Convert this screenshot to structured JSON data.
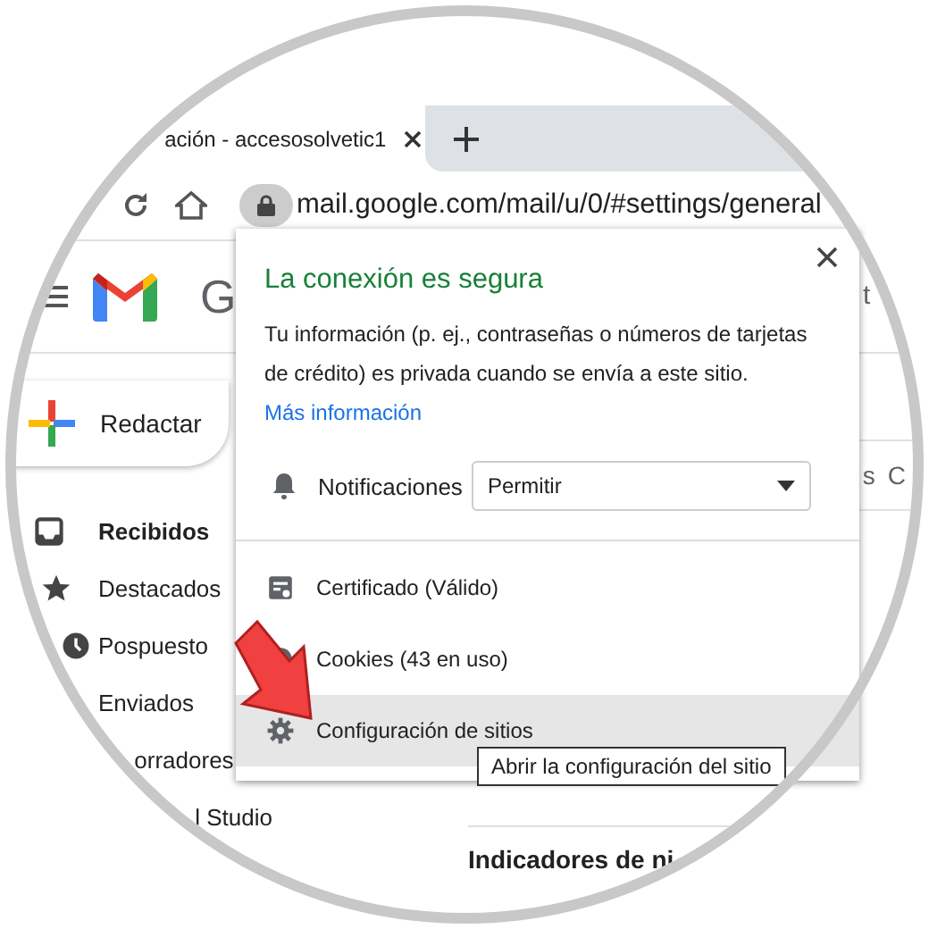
{
  "browser": {
    "tab_title": "ación - accesosolvetic1",
    "address": "mail.google.com/mail/u/0/#settings/general"
  },
  "gmail": {
    "logo_text": "G",
    "header_right": "t",
    "compose": "Redactar",
    "nav": [
      {
        "label": "Recibidos",
        "selected": true
      },
      {
        "label": "Destacados",
        "selected": false
      },
      {
        "label": "Pospuesto",
        "selected": false
      },
      {
        "label": "Enviados",
        "selected": false
      },
      {
        "label": "orradores",
        "selected": false
      },
      {
        "label": "l Studio",
        "selected": false
      }
    ],
    "tabs_fragment": [
      "s",
      "C"
    ],
    "section_heading": "Indicadores de ni"
  },
  "popup": {
    "title": "La conexión es segura",
    "description": "Tu información (p. ej., contraseñas o números de tarjetas de crédito) es privada cuando se envía a este sitio.",
    "link": "Más información",
    "permission": {
      "label": "Notificaciones",
      "value": "Permitir"
    },
    "items": [
      {
        "kind": "certificate",
        "label": "Certificado (Válido)",
        "hovered": false
      },
      {
        "kind": "cookies",
        "label": "Cookies (43 en uso)",
        "hovered": false
      },
      {
        "kind": "settings",
        "label": "Configuración de sitios",
        "hovered": true
      }
    ]
  },
  "tooltip": "Abrir la configuración del sitio"
}
